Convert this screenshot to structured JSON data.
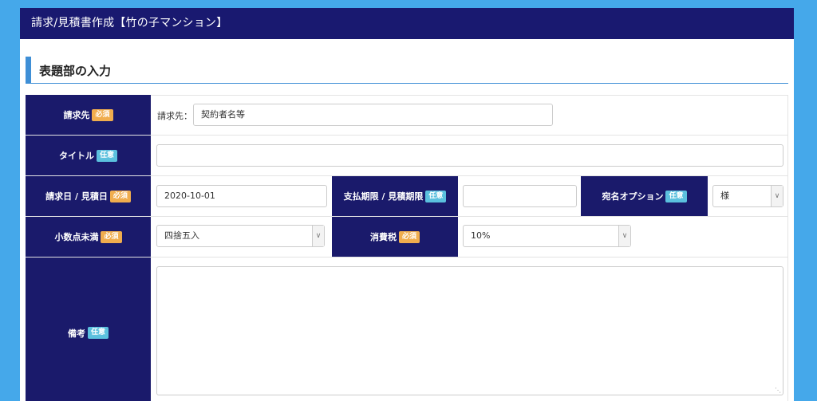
{
  "titlebar": {
    "title": "請求/見積書作成【竹の子マンション】"
  },
  "section": {
    "title": "表題部の入力"
  },
  "badges": {
    "required": "必須",
    "optional": "任意"
  },
  "fields": {
    "billing_to": {
      "label": "請求先",
      "prefix": "請求先：",
      "value": "契約者名等"
    },
    "title": {
      "label": "タイトル",
      "value": ""
    },
    "date": {
      "label": "請求日 / 見積日",
      "value": "2020-10-01"
    },
    "deadline": {
      "label": "支払期限 / 見積期限",
      "value": ""
    },
    "addressee": {
      "label": "宛名オプション",
      "selected": "様"
    },
    "rounding": {
      "label": "小数点未満",
      "selected": "四捨五入"
    },
    "tax": {
      "label": "消費税",
      "selected": "10%"
    },
    "notes": {
      "label": "備考",
      "value": ""
    }
  },
  "icons": {
    "dropdown": "chevron-down-icon",
    "resize": "resize-grip-icon"
  },
  "colors": {
    "background": "#45a8ea",
    "titlebar": "#191970",
    "label_cell": "#1a1a6b",
    "required_badge": "#f0ad4e",
    "optional_badge": "#5bc0de",
    "section_accent": "#3f8fd6"
  }
}
